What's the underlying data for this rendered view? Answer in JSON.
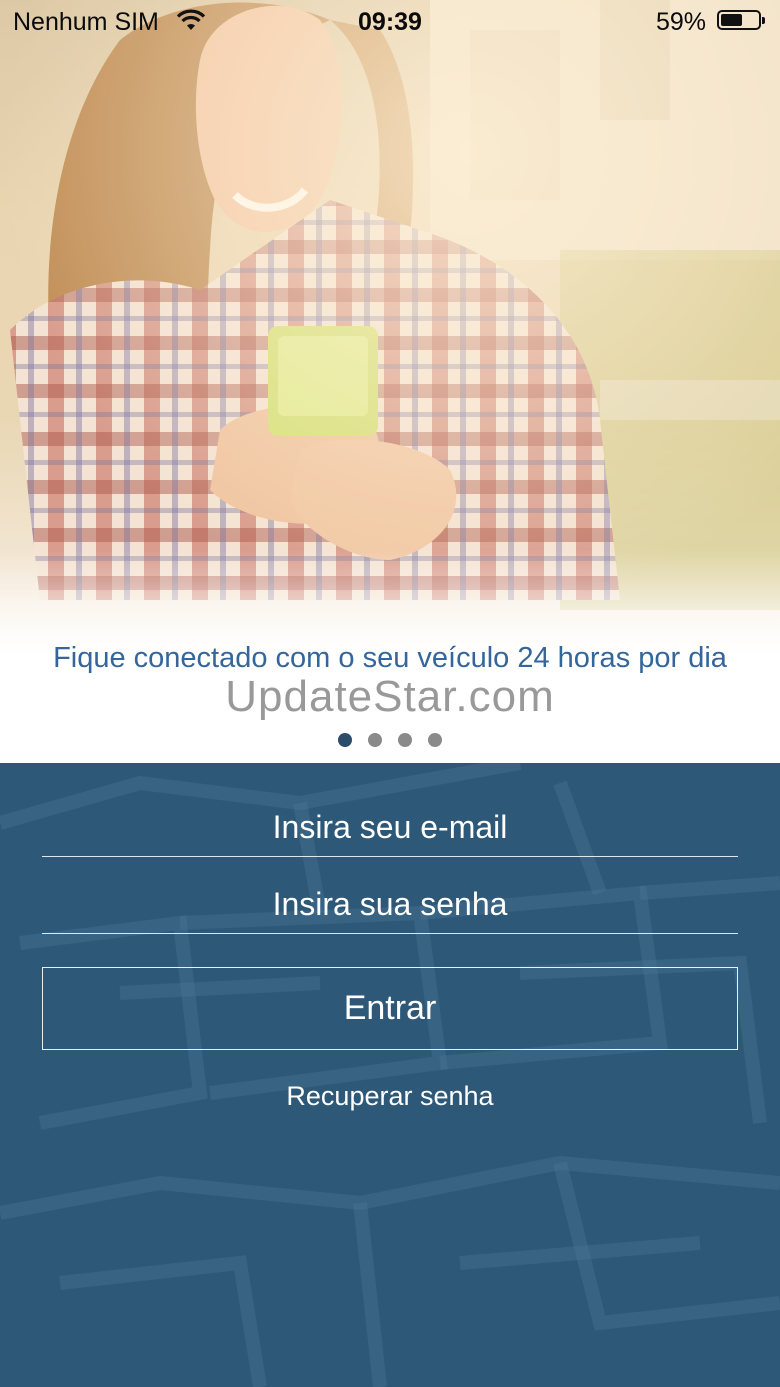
{
  "status_bar": {
    "carrier": "Nenhum SIM",
    "time": "09:39",
    "battery_percent": "59%",
    "battery_level": 0.59,
    "wifi_icon": "wifi-icon",
    "battery_icon": "battery-icon"
  },
  "hero": {
    "caption": "Fique conectado com o seu veículo 24 horas por dia",
    "watermark": "UpdateStar.com",
    "page_count": 4,
    "active_page": 1
  },
  "login": {
    "email_placeholder": "Insira seu e-mail",
    "password_placeholder": "Insira sua senha",
    "submit_label": "Entrar",
    "recover_label": "Recuperar senha"
  },
  "colors": {
    "panel_background": "#2d5878",
    "caption_text": "#35669b",
    "active_dot": "#2b4c6a"
  }
}
